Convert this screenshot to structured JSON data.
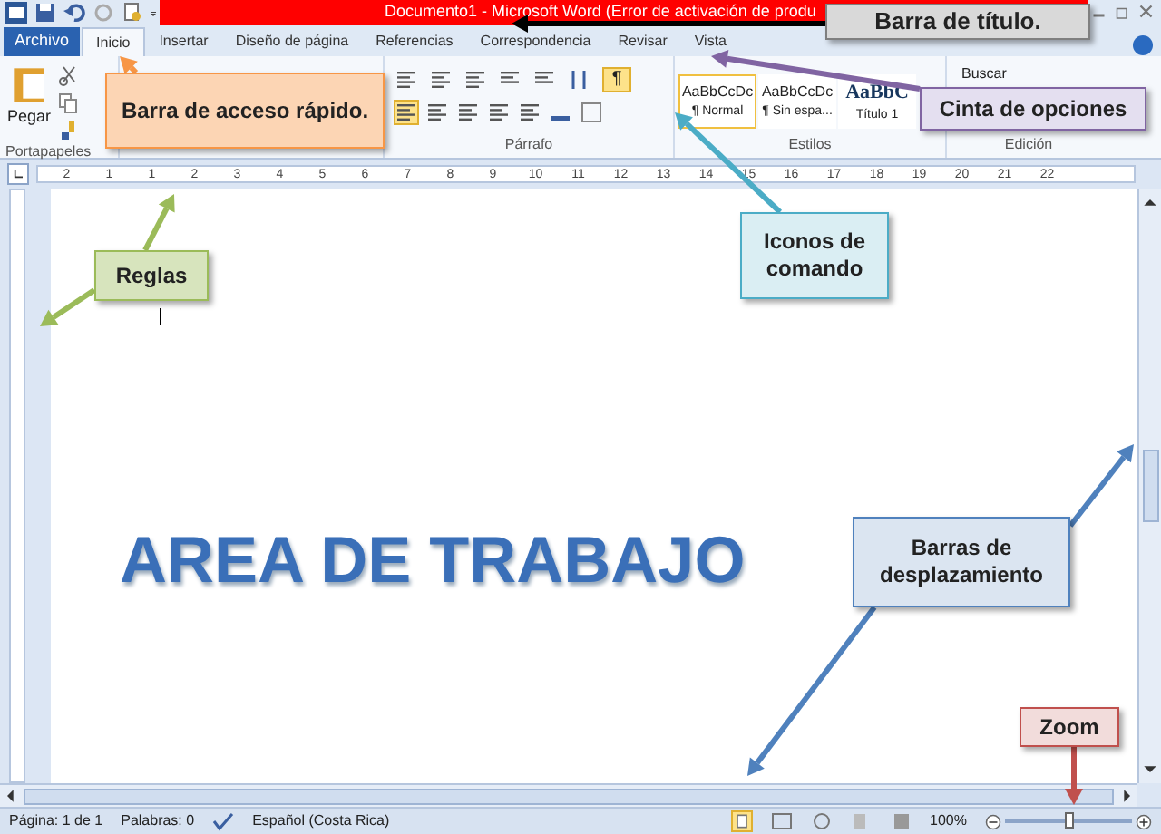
{
  "title_bar": {
    "title": "Documento1 - Microsoft Word (Error de activación de produ"
  },
  "tabs": [
    {
      "label": "Archivo",
      "kind": "file",
      "selected": false
    },
    {
      "label": "Inicio",
      "kind": "tab",
      "selected": true
    },
    {
      "label": "Insertar",
      "kind": "tab",
      "selected": false
    },
    {
      "label": "Diseño de página",
      "kind": "tab",
      "selected": false
    },
    {
      "label": "Referencias",
      "kind": "tab",
      "selected": false
    },
    {
      "label": "Correspondencia",
      "kind": "tab",
      "selected": false
    },
    {
      "label": "Revisar",
      "kind": "tab",
      "selected": false
    },
    {
      "label": "Vista",
      "kind": "tab",
      "selected": false
    }
  ],
  "ribbon": {
    "paste": "Pegar",
    "clipboard": "Portapapeles",
    "paragraph": "Párrafo",
    "pilcrow": "¶",
    "paragraph_marks_on": true,
    "align_left_on": true,
    "styles": [
      {
        "sample": "AaBbCcDc",
        "name": "¶ Normal",
        "selected": true
      },
      {
        "sample": "AaBbCcDc",
        "name": "¶ Sin espa...",
        "selected": false
      },
      {
        "sample": "AaBbC",
        "name": "Título 1",
        "selected": false
      }
    ],
    "styles_label": "Estilos",
    "find": "Buscar",
    "editing_label": "Edición"
  },
  "ruler": {
    "numbers": [
      "2",
      "1",
      "1",
      "2",
      "3",
      "4",
      "5",
      "6",
      "7",
      "8",
      "9",
      "10",
      "11",
      "12",
      "13",
      "14",
      "15",
      "16",
      "17",
      "18",
      "19",
      "20",
      "21",
      "22"
    ]
  },
  "document": {
    "heading": "AREA DE TRABAJO"
  },
  "status_bar": {
    "page": "Página: 1 de 1",
    "words": "Palabras: 0",
    "language": "Español (Costa Rica)",
    "zoom": "100%",
    "zoom_slider": {
      "level": 0.5
    }
  },
  "callouts": [
    {
      "text": "Barra de título.",
      "color": "#d9d9d9"
    },
    {
      "text": "Barra de acceso rápido.",
      "color": "#fcd5b4"
    },
    {
      "text": "Cinta de opciones",
      "color": "#e4dff0"
    },
    {
      "text": "Iconos de comando",
      "color": "#daeef3"
    },
    {
      "text": "Reglas",
      "color": "#d7e4bd"
    },
    {
      "text": "Barras de desplazamiento",
      "color": "#dbe5f1"
    },
    {
      "text": "Zoom",
      "color": "#f2dcdb"
    }
  ]
}
